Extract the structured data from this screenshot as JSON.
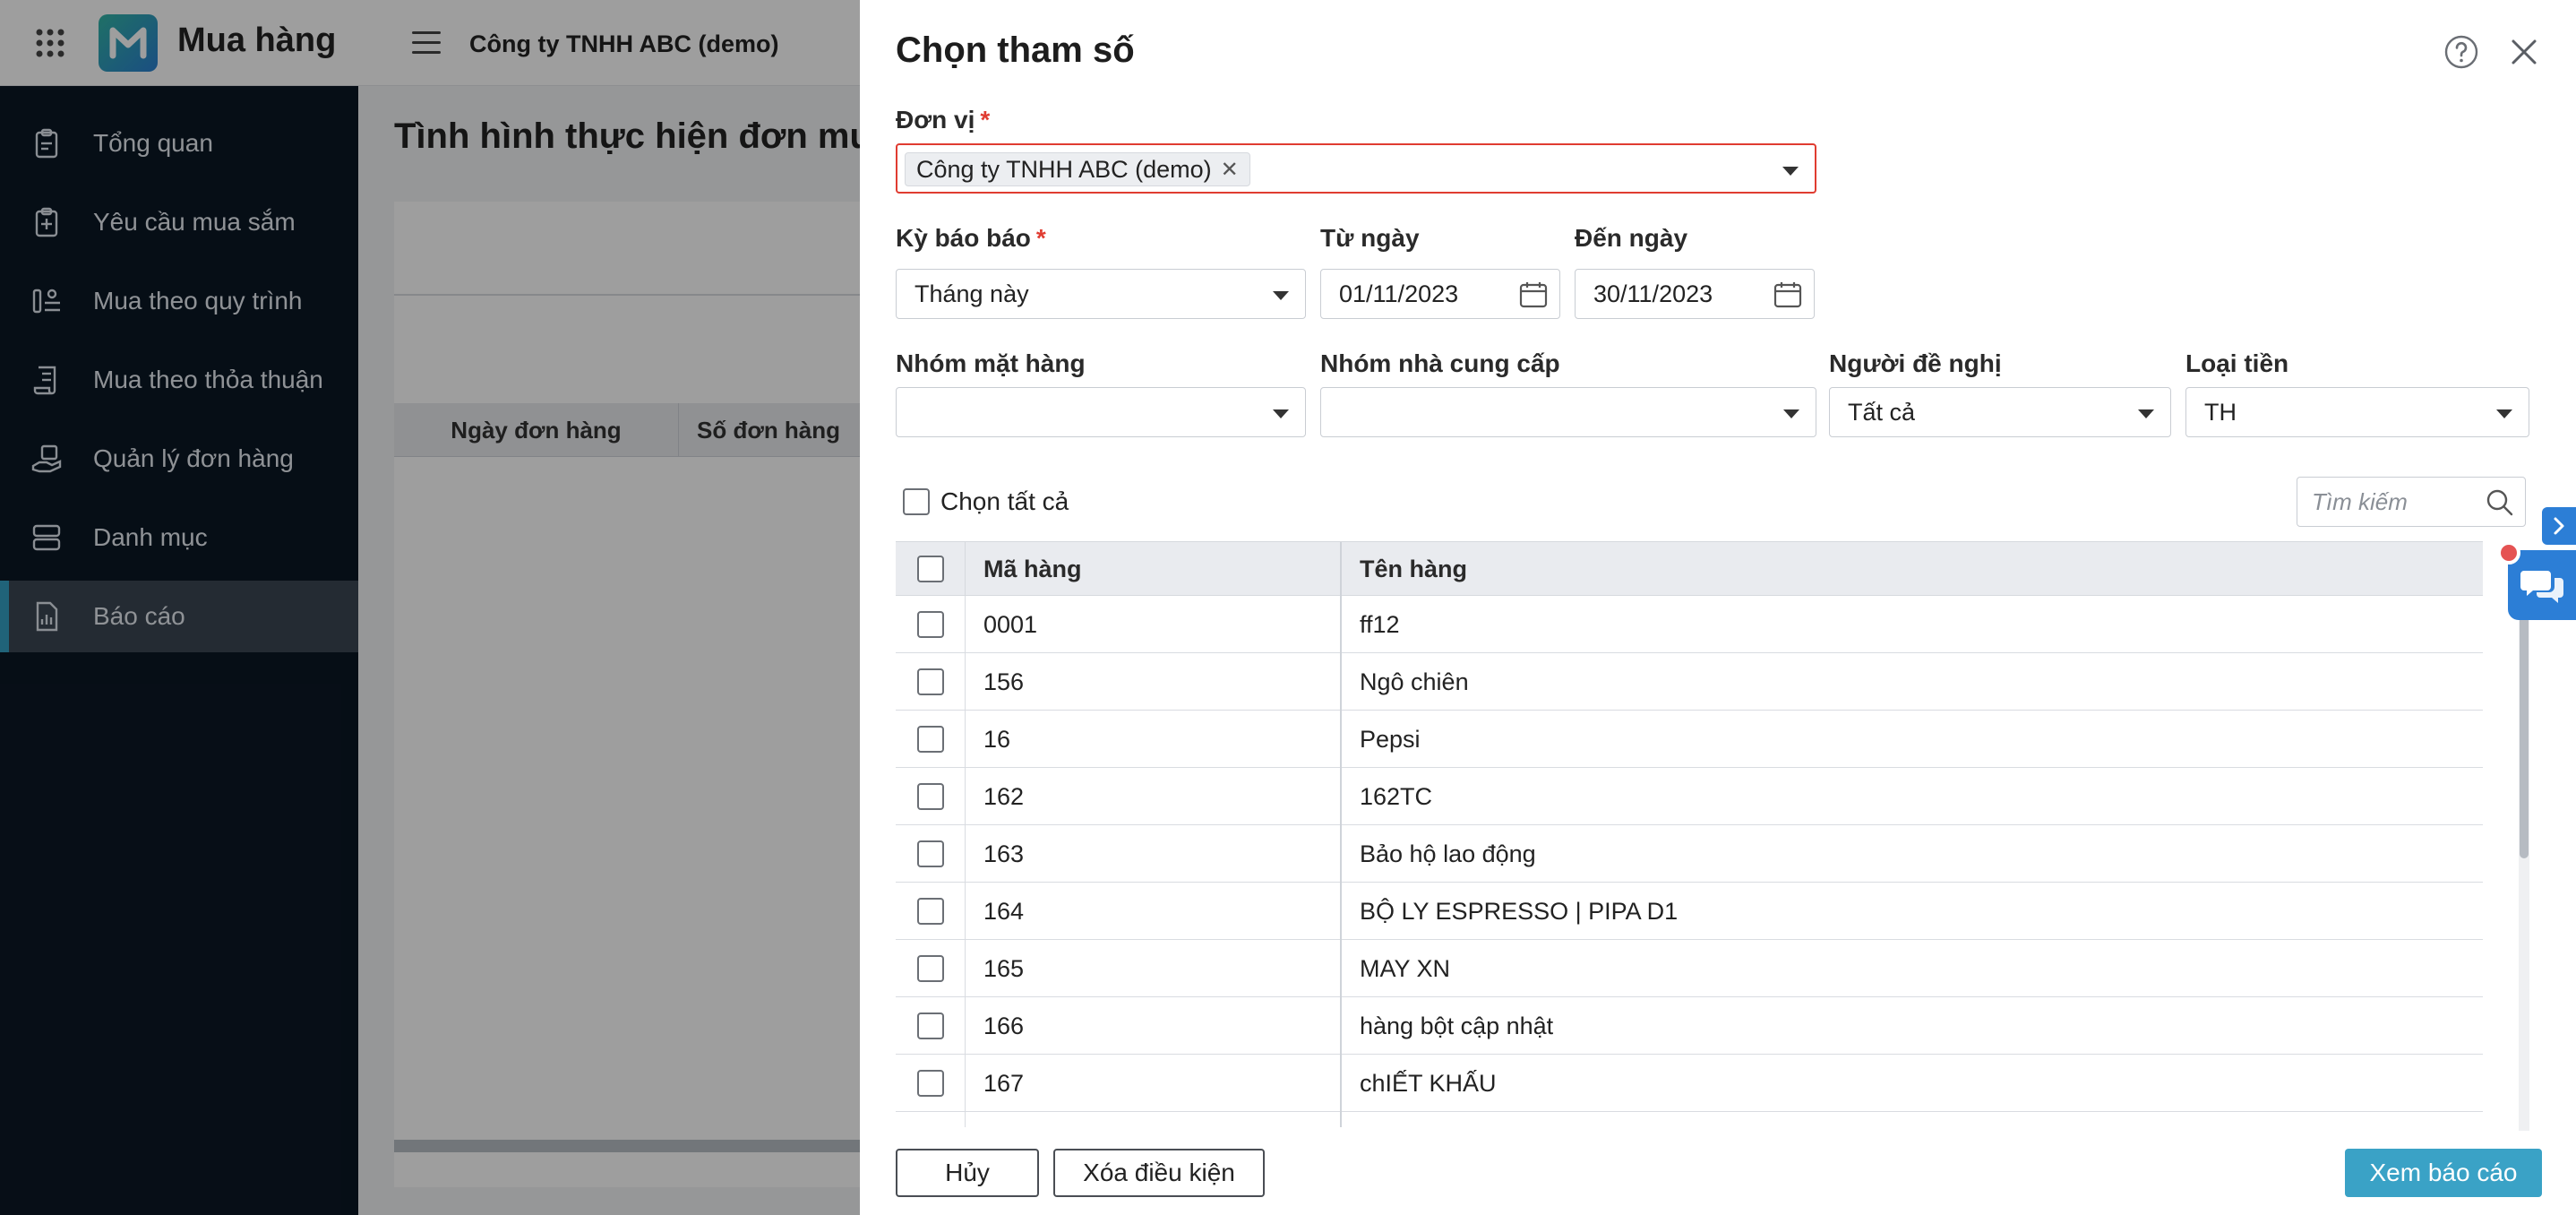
{
  "app": {
    "title": "Mua hàng",
    "company": "Công ty TNHH ABC (demo)"
  },
  "sidebar": {
    "items": [
      {
        "label": "Tổng quan",
        "icon": "clipboard-icon"
      },
      {
        "label": "Yêu cầu mua sắm",
        "icon": "clipboard-plus-icon"
      },
      {
        "label": "Mua theo quy trình",
        "icon": "process-icon"
      },
      {
        "label": "Mua theo thỏa thuận",
        "icon": "contract-icon"
      },
      {
        "label": "Quản lý đơn hàng",
        "icon": "hand-box-icon"
      },
      {
        "label": "Danh mục",
        "icon": "list-icon"
      },
      {
        "label": "Báo cáo",
        "icon": "report-icon",
        "active": true
      }
    ]
  },
  "main": {
    "title": "Tình hình thực hiện đơn mu",
    "columns": [
      "Ngày đơn hàng",
      "Số đơn hàng"
    ]
  },
  "dialog": {
    "title": "Chọn tham số",
    "unit": {
      "label": "Đơn vị",
      "required": "*",
      "selected": "Công ty TNHH ABC (demo)"
    },
    "period": {
      "label": "Kỳ báo báo",
      "required": "*",
      "value": "Tháng này"
    },
    "from_date": {
      "label": "Từ ngày",
      "value": "01/11/2023"
    },
    "to_date": {
      "label": "Đến ngày",
      "value": "30/11/2023"
    },
    "item_group": {
      "label": "Nhóm mặt hàng",
      "value": ""
    },
    "supplier_group": {
      "label": "Nhóm nhà cung cấp",
      "value": ""
    },
    "requester": {
      "label": "Người đề nghị",
      "value": "Tất cả"
    },
    "currency": {
      "label": "Loại tiền",
      "value": "TH"
    },
    "select_all_label": "Chọn tất cả",
    "search_placeholder": "Tìm kiếm",
    "table": {
      "headers": {
        "code": "Mã hàng",
        "name": "Tên hàng"
      },
      "rows": [
        {
          "code": "0001",
          "name": "ff12"
        },
        {
          "code": "156",
          "name": "Ngô chiên"
        },
        {
          "code": "16",
          "name": "Pepsi"
        },
        {
          "code": "162",
          "name": "162TC"
        },
        {
          "code": "163",
          "name": "Bảo hộ lao động"
        },
        {
          "code": "164",
          "name": "BỘ LY ESPRESSO | PIPA D1"
        },
        {
          "code": "165",
          "name": "MAY XN"
        },
        {
          "code": "166",
          "name": "hàng bột cập nhật"
        },
        {
          "code": "167",
          "name": "chIẾT KHẤU"
        },
        {
          "code": "",
          "name": ""
        }
      ]
    },
    "buttons": {
      "cancel": "Hủy",
      "clear": "Xóa điều kiện",
      "view": "Xem báo cáo"
    }
  },
  "colors": {
    "sidebar_bg": "#0b1725",
    "accent": "#3aa2c6",
    "required": "#e03c31",
    "chat": "#2c7ed6"
  }
}
